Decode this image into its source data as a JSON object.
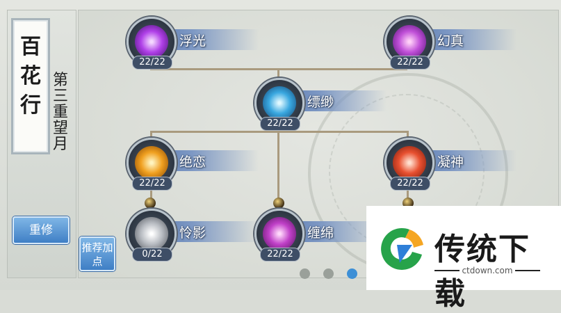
{
  "sect": {
    "name": "百花行",
    "subtitle": "第三重望月"
  },
  "buttons": {
    "reset": "重修",
    "recommend": "推荐加点"
  },
  "skills": [
    {
      "name": "浮光",
      "count": "22/22",
      "color": "#a040d8"
    },
    {
      "name": "幻真",
      "count": "22/22",
      "color": "#b048d0"
    },
    {
      "name": "缥缈",
      "count": "22/22",
      "color": "#3aa8e0"
    },
    {
      "name": "绝恋",
      "count": "22/22",
      "color": "#f0a020"
    },
    {
      "name": "凝神",
      "count": "22/22",
      "color": "#e85030"
    },
    {
      "name": "怜影",
      "count": "0/22",
      "color": "#b8bcc2"
    },
    {
      "name": "缠绵",
      "count": "22/22",
      "color": "#c040c8"
    }
  ],
  "pager": {
    "pages": 4,
    "active": 3
  },
  "watermark": {
    "title": "传统下载",
    "url": "ctdown.com"
  }
}
